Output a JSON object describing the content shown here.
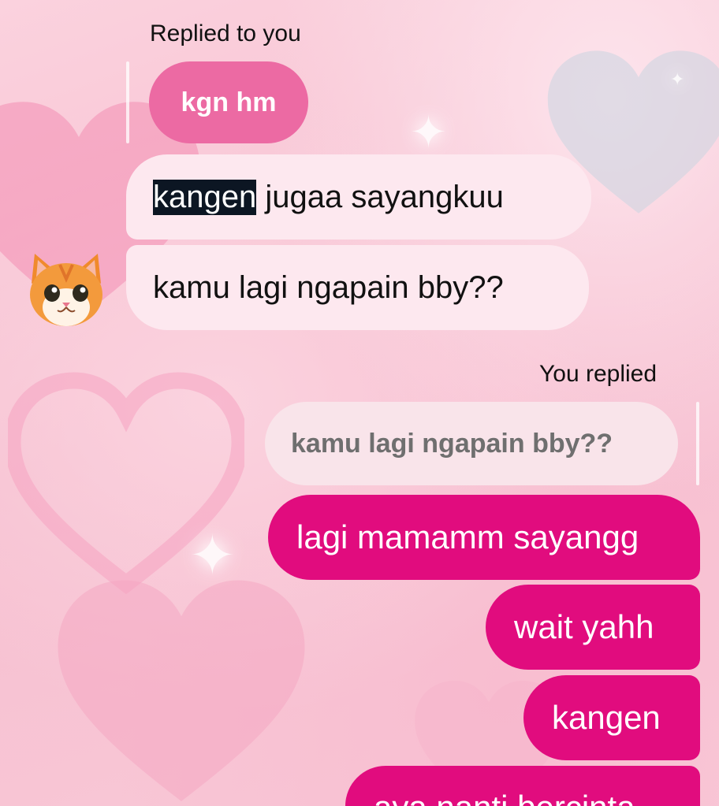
{
  "thread": {
    "incoming_reply_label": "Replied to you",
    "incoming_quoted_text": "kgn hm",
    "incoming_messages": [
      {
        "highlighted": "kangen",
        "rest": " jugaa sayangkuu"
      },
      {
        "text": "kamu lagi ngapain bby??"
      }
    ],
    "outgoing_reply_label": "You replied",
    "outgoing_quoted_text": "kamu lagi ngapain bby??",
    "outgoing_messages": [
      "lagi mamamm sayangg",
      "wait yahh",
      "kangen",
      "aya nanti bercinta"
    ]
  },
  "avatar": {
    "icon": "cat-avatar-icon"
  },
  "colors": {
    "outgoing_bubble": "#e10c7e",
    "quoted_them_bubble": "#ec6aa3",
    "incoming_bubble": "#fde8ef",
    "quoted_me_bubble": "#f9e4ea",
    "selection_highlight": "#0c1623"
  }
}
